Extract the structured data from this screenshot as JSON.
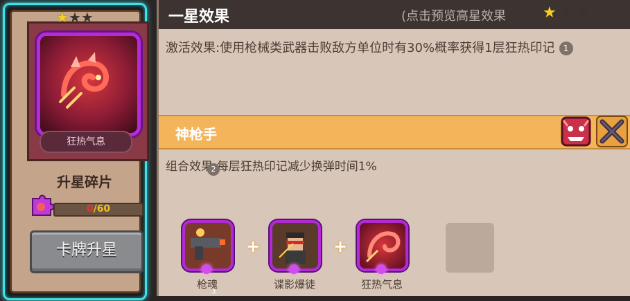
{
  "card": {
    "name": "狂热气息",
    "stars": [
      "gold",
      "dark",
      "dark"
    ],
    "fragment_title": "升星碎片",
    "fragment_progress": {
      "current": "0",
      "separator": "/",
      "max": "60",
      "fraction": 0
    },
    "upgrade_button": "卡牌升星"
  },
  "effect": {
    "title": "一星效果",
    "hint": "(点击预览高星效果",
    "stars": [
      "gold",
      "dark",
      "dark"
    ],
    "activation": "激活效果:使用枪械类武器击败敌方单位时有30%概率获得1层狂热印记",
    "activation_note": "1"
  },
  "combo": {
    "title": "神枪手",
    "icons": [
      "demon-mask-icon",
      "crossed-guns-icon"
    ],
    "effect": "组合效果:每层狂热印记减少换弹时间1%",
    "effect_note": "2",
    "ingredients": [
      {
        "label": "枪魂",
        "icon": "gun-soul-icon"
      },
      {
        "label": "谍影爆徒",
        "icon": "ninja-icon"
      },
      {
        "label": "狂热气息",
        "icon": "frenzy-dragon-icon"
      }
    ],
    "tiny_mark": "3"
  },
  "colors": {
    "card_glow": "#3fe0e8",
    "combo_bar": "#f3b45a",
    "rare_frame": "#b22ad6",
    "star_gold": "#f6cf2d"
  }
}
